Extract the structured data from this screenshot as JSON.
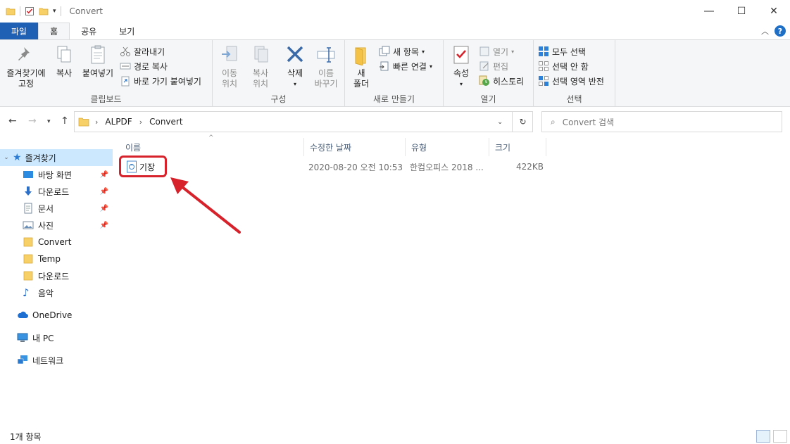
{
  "window": {
    "title": "Convert"
  },
  "ribbon_tabs": [
    "파일",
    "홈",
    "공유",
    "보기"
  ],
  "ribbon": {
    "clipboard": {
      "pin_label": "즐겨찾기에\n고정",
      "copy_label": "복사",
      "paste_label": "붙여넣기",
      "cut_label": "잘라내기",
      "copy_path_label": "경로 복사",
      "paste_shortcut_label": "바로 가기 붙여넣기",
      "group_label": "클립보드"
    },
    "organize": {
      "move_label": "이동\n위치",
      "copyto_label": "복사\n위치",
      "delete_label": "삭제",
      "rename_label": "이름\n바꾸기",
      "group_label": "구성"
    },
    "new": {
      "new_folder_label": "새\n폴더",
      "new_item_label": "새 항목",
      "easy_access_label": "빠른 연결",
      "group_label": "새로 만들기"
    },
    "open": {
      "properties_label": "속성",
      "open_label": "열기",
      "edit_label": "편집",
      "history_label": "히스토리",
      "group_label": "열기"
    },
    "select": {
      "select_all_label": "모두 선택",
      "select_none_label": "선택 안 함",
      "invert_label": "선택 영역 반전",
      "group_label": "선택"
    }
  },
  "address": {
    "crumbs": [
      "ALPDF",
      "Convert"
    ],
    "search_placeholder": "Convert 검색"
  },
  "nav_pane": {
    "quick_access": "즐겨찾기",
    "items": [
      {
        "label": "바탕 화면",
        "pinned": true
      },
      {
        "label": "다운로드",
        "pinned": true
      },
      {
        "label": "문서",
        "pinned": true
      },
      {
        "label": "사진",
        "pinned": true
      },
      {
        "label": "Convert",
        "pinned": false
      },
      {
        "label": "Temp",
        "pinned": false
      },
      {
        "label": "다운로드",
        "pinned": false
      },
      {
        "label": "음악",
        "pinned": false
      }
    ],
    "onedrive": "OneDrive",
    "this_pc": "내 PC",
    "network": "네트워크"
  },
  "file_list": {
    "columns": [
      "이름",
      "수정한 날짜",
      "유형",
      "크기"
    ],
    "rows": [
      {
        "name": "기장",
        "modified": "2020-08-20 오전 10:53",
        "type": "한컴오피스 2018 ...",
        "size": "422KB"
      }
    ]
  },
  "status_bar": {
    "count": "1개 항목"
  },
  "colors": {
    "file_tab": "#1f5fb4",
    "selection": "#cce8ff",
    "annotation": "#d7222b"
  }
}
